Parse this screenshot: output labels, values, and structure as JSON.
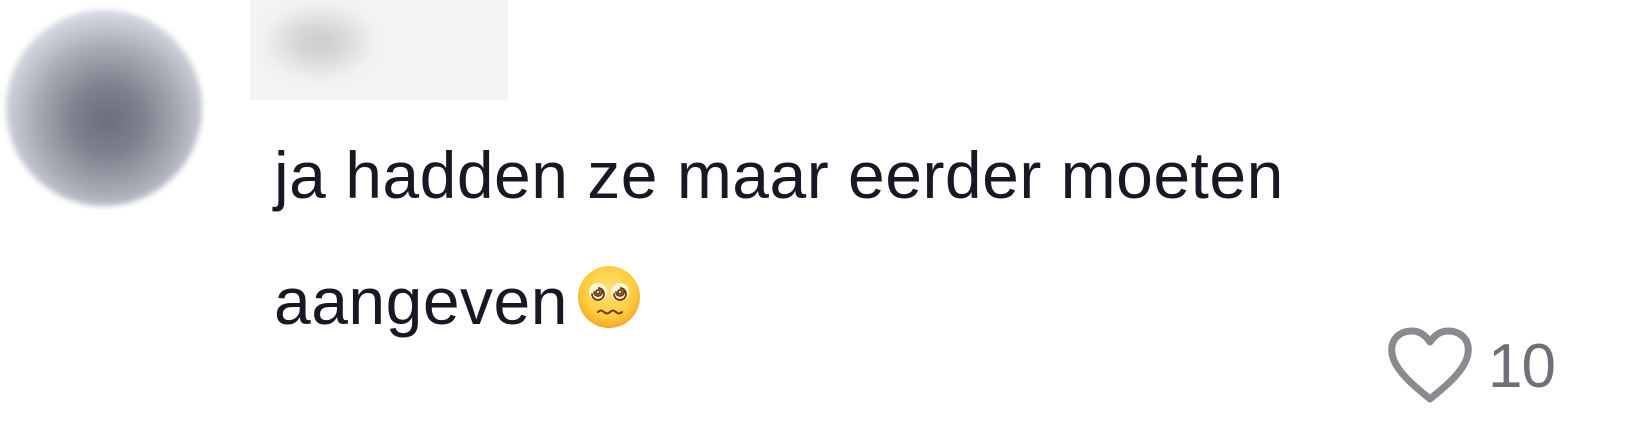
{
  "comment": {
    "username": "",
    "text": "ja hadden ze maar eerder moeten aangeven",
    "emoji": "face-with-spiral-eyes-icon",
    "likes": "10"
  },
  "colors": {
    "text": "#161823",
    "muted": "#6f7078",
    "heart_stroke": "#8a8b91"
  }
}
